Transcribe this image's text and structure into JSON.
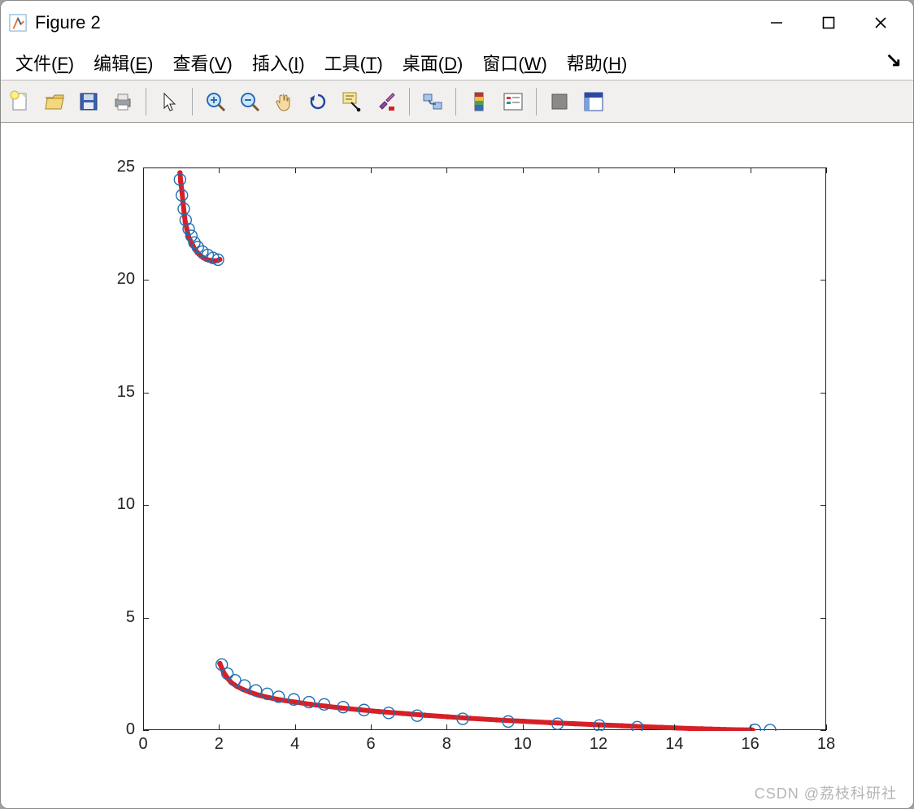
{
  "window": {
    "title": "Figure 2"
  },
  "menu": {
    "file": {
      "label": "文件",
      "mnemonic": "F"
    },
    "edit": {
      "label": "编辑",
      "mnemonic": "E"
    },
    "view": {
      "label": "查看",
      "mnemonic": "V"
    },
    "insert": {
      "label": "插入",
      "mnemonic": "I"
    },
    "tools": {
      "label": "工具",
      "mnemonic": "T"
    },
    "desktop": {
      "label": "桌面",
      "mnemonic": "D"
    },
    "window": {
      "label": "窗口",
      "mnemonic": "W"
    },
    "help": {
      "label": "帮助",
      "mnemonic": "H"
    }
  },
  "toolbar_icons": {
    "new": "new",
    "open": "open",
    "save": "save",
    "print": "print",
    "pointer": "pointer",
    "zoom_in": "zoom_in",
    "zoom_out": "zoom_out",
    "pan": "pan",
    "rotate": "rotate",
    "data_cursor": "data_cursor",
    "brush": "brush",
    "link": "link",
    "colorbar": "colorbar",
    "legend": "legend",
    "hide": "hide",
    "dock": "dock"
  },
  "watermark": "CSDN @荔枝科研社",
  "chart_data": {
    "type": "scatter",
    "xlabel": "",
    "ylabel": "",
    "xlim": [
      0,
      18
    ],
    "ylim": [
      0,
      25
    ],
    "xticks": [
      0,
      2,
      4,
      6,
      8,
      10,
      12,
      14,
      16,
      18
    ],
    "yticks": [
      0,
      5,
      10,
      15,
      20,
      25
    ],
    "grid": false,
    "series": [
      {
        "name": "red-dots",
        "style": "dots",
        "color": "#d62026",
        "x": [
          0.95,
          0.97,
          1.0,
          1.03,
          1.06,
          1.09,
          1.13,
          1.17,
          1.22,
          1.28,
          1.34,
          1.41,
          1.49,
          1.57,
          1.64,
          1.71,
          1.78,
          1.84,
          1.89,
          1.94,
          2.0,
          2.0,
          2.1,
          2.2,
          2.3,
          2.45,
          2.6,
          2.8,
          3.0,
          3.3,
          3.6,
          4.0,
          4.4,
          4.8,
          5.2,
          5.7,
          6.2,
          6.8,
          7.4,
          8.0,
          8.6,
          9.3,
          10.0,
          10.7,
          11.35,
          12.0,
          12.6,
          13.15,
          13.65,
          14.05,
          14.4,
          14.7,
          14.95,
          15.15,
          15.3,
          15.45,
          15.57,
          15.68,
          15.78,
          15.86,
          15.93,
          15.99,
          16.04
        ],
        "y": [
          24.8,
          24.4,
          24.0,
          23.5,
          23.0,
          22.6,
          22.3,
          22.0,
          21.8,
          21.6,
          21.4,
          21.25,
          21.12,
          21.02,
          20.96,
          20.92,
          20.9,
          20.89,
          20.89,
          20.9,
          20.95,
          3.0,
          2.6,
          2.35,
          2.15,
          1.98,
          1.85,
          1.72,
          1.6,
          1.48,
          1.38,
          1.28,
          1.18,
          1.1,
          1.02,
          0.94,
          0.86,
          0.78,
          0.7,
          0.63,
          0.56,
          0.49,
          0.43,
          0.37,
          0.32,
          0.27,
          0.23,
          0.19,
          0.16,
          0.13,
          0.11,
          0.095,
          0.082,
          0.072,
          0.064,
          0.058,
          0.053,
          0.049,
          0.046,
          0.044,
          0.042,
          0.041,
          0.04
        ]
      },
      {
        "name": "blue-circles",
        "style": "open-circles",
        "color": "#1f6fb4",
        "x": [
          0.95,
          1.0,
          1.05,
          1.1,
          1.18,
          1.25,
          1.33,
          1.42,
          1.54,
          1.68,
          1.82,
          1.95,
          2.05,
          2.2,
          2.4,
          2.65,
          2.95,
          3.25,
          3.55,
          3.95,
          4.35,
          4.75,
          5.25,
          5.8,
          6.45,
          7.2,
          8.4,
          9.6,
          10.9,
          12.0,
          13.0,
          16.1,
          16.5
        ],
        "y": [
          24.5,
          23.8,
          23.2,
          22.7,
          22.3,
          22.0,
          21.7,
          21.5,
          21.3,
          21.15,
          21.02,
          20.94,
          2.95,
          2.55,
          2.25,
          2.02,
          1.8,
          1.65,
          1.52,
          1.4,
          1.28,
          1.18,
          1.06,
          0.93,
          0.8,
          0.68,
          0.54,
          0.42,
          0.32,
          0.24,
          0.17,
          0.05,
          0.04
        ]
      }
    ]
  }
}
